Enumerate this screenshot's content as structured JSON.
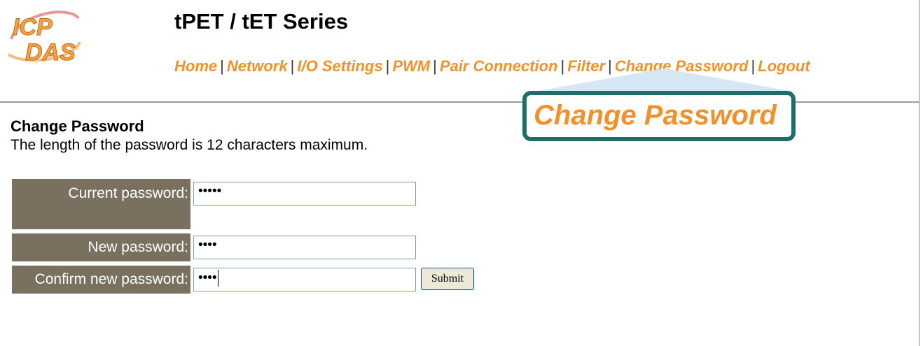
{
  "header": {
    "logo_text": "ICP DAS",
    "title": "tPET / tET Series",
    "nav": [
      "Home",
      "Network",
      "I/O Settings",
      "PWM",
      "Pair Connection",
      "Filter",
      "Change Password",
      "Logout"
    ],
    "separator": "|"
  },
  "callout": {
    "text": "Change Password"
  },
  "main": {
    "section_title": "Change Password",
    "description": "The length of the password is 12 characters maximum.",
    "fields": [
      {
        "label": "Current password:",
        "value": "•••••"
      },
      {
        "label": "New password:",
        "value": "••••"
      },
      {
        "label": "Confirm new password:",
        "value": "••••"
      }
    ],
    "submit_label": "Submit"
  },
  "colors": {
    "accent_orange": "#f0922b",
    "label_bg": "#7a7060",
    "callout_border": "#1f6e6c"
  }
}
